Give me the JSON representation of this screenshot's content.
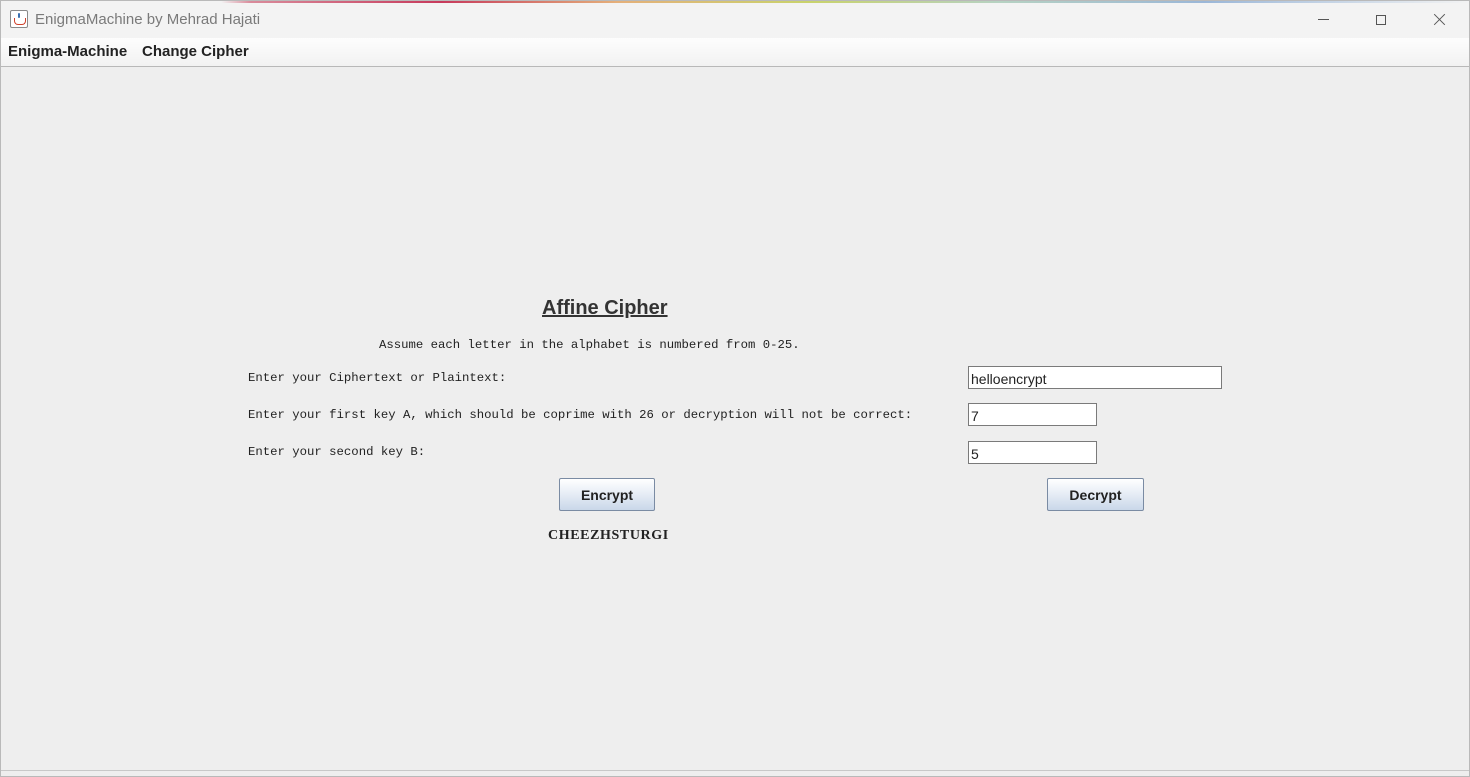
{
  "window": {
    "title": "EnigmaMachine by Mehrad Hajati"
  },
  "menubar": {
    "items": [
      {
        "label": "Enigma-Machine"
      },
      {
        "label": "Change Cipher"
      }
    ]
  },
  "cipher": {
    "heading": "Affine Cipher",
    "note": "Assume each letter in the alphabet is numbered from 0-25.",
    "text_label": "Enter your Ciphertext or Plaintext:",
    "text_value": "helloencrypt",
    "key_a_label": "Enter your first key A, which should be coprime with 26 or decryption will not be correct:",
    "key_a_value": "7",
    "key_b_label": "Enter your second key B:",
    "key_b_value": "5",
    "encrypt_label": "Encrypt",
    "decrypt_label": "Decrypt",
    "result": "CHEEZHSTURGI"
  },
  "icons": {
    "app": "java-cup-icon",
    "minimize": "minimize-icon",
    "maximize": "maximize-icon",
    "close": "close-icon"
  }
}
